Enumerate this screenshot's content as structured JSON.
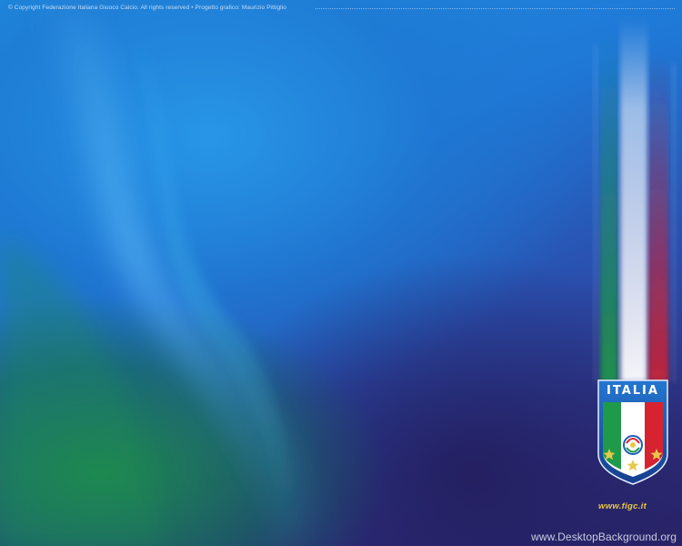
{
  "wallpaper": {
    "copyright": "© Copyright Federazione Italiana Giuoco Calcio. All rights reserved • Progetto grafico: Maurizio Pittiglio",
    "crest": {
      "title": "ITALIA",
      "stars": 3,
      "website": "www.figc.it"
    },
    "watermark": "www.DesktopBackground.org",
    "colors": {
      "blue": "#1f8fe0",
      "deep_blue": "#2e2f7e",
      "green": "#1e8c46",
      "flag_green": "#1f9a4a",
      "flag_white": "#ffffff",
      "flag_red": "#d7232f",
      "crest_blue": "#1c5fb8",
      "gold": "#e6c84a"
    },
    "icons": [
      "figc-crest-icon",
      "star-icon"
    ]
  }
}
